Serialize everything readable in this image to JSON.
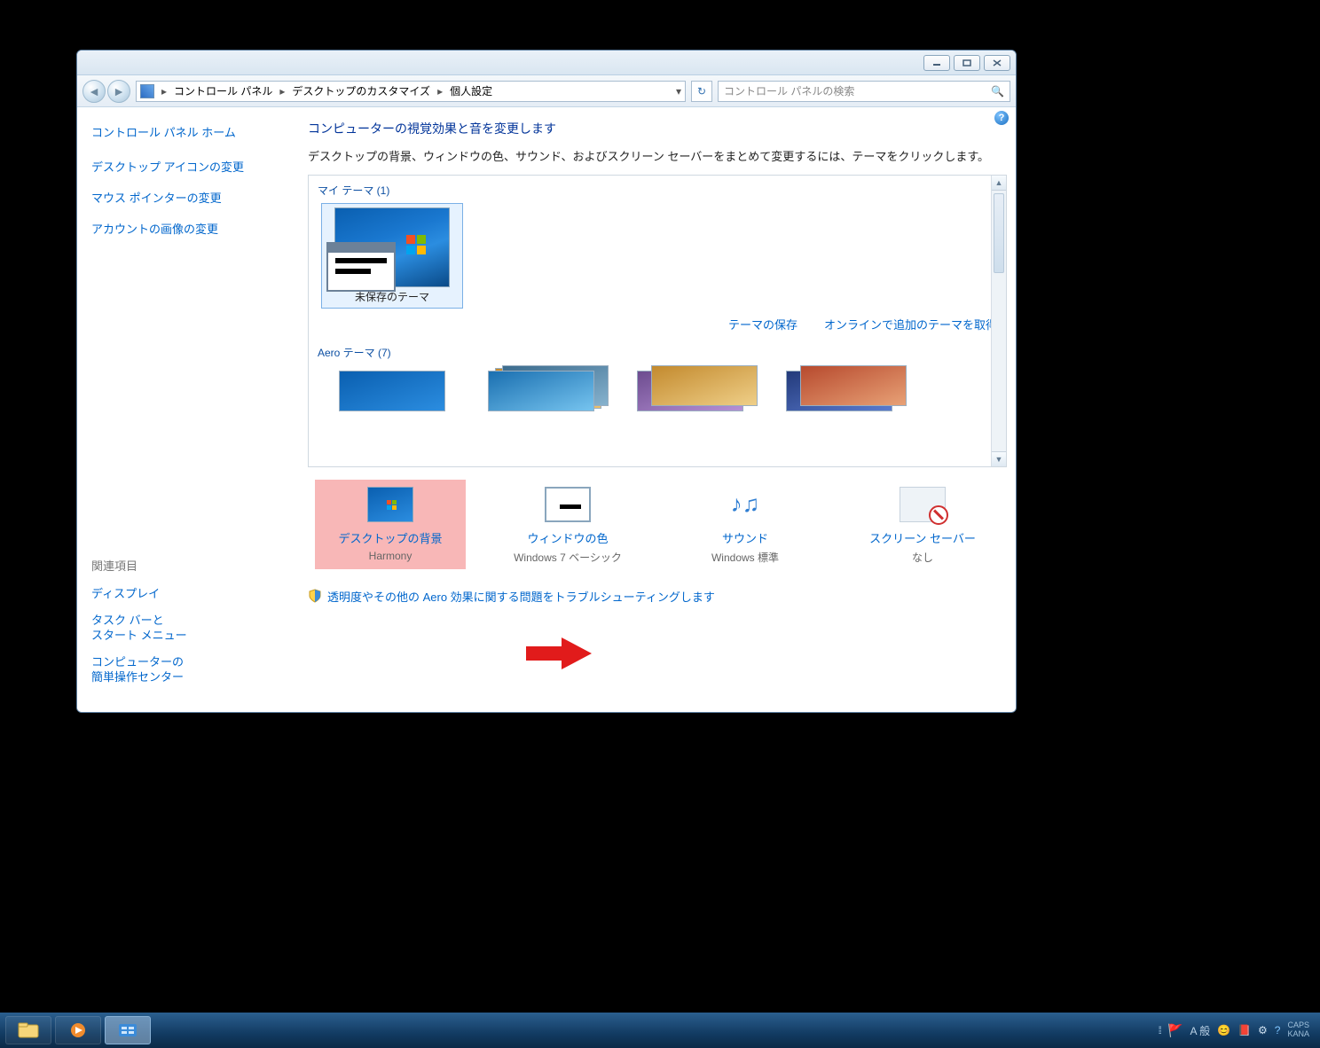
{
  "breadcrumb": {
    "p1": "コントロール パネル",
    "p2": "デスクトップのカスタマイズ",
    "p3": "個人設定"
  },
  "search": {
    "placeholder": "コントロール パネルの検索"
  },
  "sidebar": {
    "home": "コントロール パネル ホーム",
    "tasks": [
      "デスクトップ アイコンの変更",
      "マウス ポインターの変更",
      "アカウントの画像の変更"
    ],
    "related_header": "関連項目",
    "related": [
      "ディスプレイ",
      "タスク バーと\nスタート メニュー",
      "コンピューターの\n簡単操作センター"
    ]
  },
  "main": {
    "heading": "コンピューターの視覚効果と音を変更します",
    "description": "デスクトップの背景、ウィンドウの色、サウンド、およびスクリーン セーバーをまとめて変更するには、テーマをクリックします。",
    "group_my": "マイ テーマ (1)",
    "theme_unsaved": "未保存のテーマ",
    "link_save": "テーマの保存",
    "link_online": "オンラインで追加のテーマを取得",
    "group_aero": "Aero テーマ (7)",
    "bottom": [
      {
        "title": "デスクトップの背景",
        "value": "Harmony"
      },
      {
        "title": "ウィンドウの色",
        "value": "Windows 7 ベーシック"
      },
      {
        "title": "サウンド",
        "value": "Windows 標準"
      },
      {
        "title": "スクリーン セーバー",
        "value": "なし"
      }
    ],
    "troubleshoot": "透明度やその他の Aero 効果に関する問題をトラブルシューティングします"
  },
  "ime": {
    "mode": "A 般"
  },
  "tray": {
    "caps": "CAPS",
    "kana": "KANA"
  }
}
